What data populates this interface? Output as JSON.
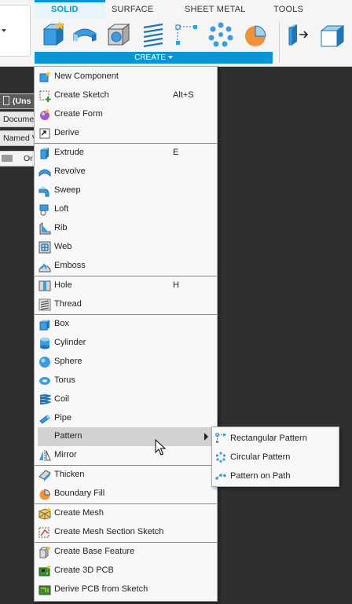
{
  "ribbon": {
    "tabs": [
      "SOLID",
      "SURFACE",
      "SHEET METAL",
      "TOOLS"
    ],
    "create_label": "CREATE"
  },
  "browser": {
    "unsaved": "(Uns",
    "document": "Docume",
    "named": "Named V",
    "origin": "Or"
  },
  "menu": {
    "items": [
      {
        "label": "New Component",
        "shortcut": "",
        "icon": "new-component-icon"
      },
      {
        "label": "Create Sketch",
        "shortcut": "Alt+S",
        "icon": "sketch-icon"
      },
      {
        "label": "Create Form",
        "shortcut": "",
        "icon": "form-icon"
      },
      {
        "label": "Derive",
        "shortcut": "",
        "icon": "derive-icon"
      },
      {
        "label": "Extrude",
        "shortcut": "E",
        "icon": "extrude-icon"
      },
      {
        "label": "Revolve",
        "shortcut": "",
        "icon": "revolve-icon"
      },
      {
        "label": "Sweep",
        "shortcut": "",
        "icon": "sweep-icon"
      },
      {
        "label": "Loft",
        "shortcut": "",
        "icon": "loft-icon"
      },
      {
        "label": "Rib",
        "shortcut": "",
        "icon": "rib-icon"
      },
      {
        "label": "Web",
        "shortcut": "",
        "icon": "web-icon"
      },
      {
        "label": "Emboss",
        "shortcut": "",
        "icon": "emboss-icon"
      },
      {
        "label": "Hole",
        "shortcut": "H",
        "icon": "hole-icon"
      },
      {
        "label": "Thread",
        "shortcut": "",
        "icon": "thread-icon"
      },
      {
        "label": "Box",
        "shortcut": "",
        "icon": "box-icon"
      },
      {
        "label": "Cylinder",
        "shortcut": "",
        "icon": "cylinder-icon"
      },
      {
        "label": "Sphere",
        "shortcut": "",
        "icon": "sphere-icon"
      },
      {
        "label": "Torus",
        "shortcut": "",
        "icon": "torus-icon"
      },
      {
        "label": "Coil",
        "shortcut": "",
        "icon": "coil-icon"
      },
      {
        "label": "Pipe",
        "shortcut": "",
        "icon": "pipe-icon"
      },
      {
        "label": "Pattern",
        "shortcut": "",
        "icon": ""
      },
      {
        "label": "Mirror",
        "shortcut": "",
        "icon": "mirror-icon"
      },
      {
        "label": "Thicken",
        "shortcut": "",
        "icon": "thicken-icon"
      },
      {
        "label": "Boundary Fill",
        "shortcut": "",
        "icon": "boundary-fill-icon"
      },
      {
        "label": "Create Mesh",
        "shortcut": "",
        "icon": "mesh-icon"
      },
      {
        "label": "Create Mesh Section Sketch",
        "shortcut": "",
        "icon": "mesh-section-sketch-icon"
      },
      {
        "label": "Create Base Feature",
        "shortcut": "",
        "icon": "base-feature-icon"
      },
      {
        "label": "Create 3D PCB",
        "shortcut": "",
        "icon": "pcb-3d-icon"
      },
      {
        "label": "Derive PCB from Sketch",
        "shortcut": "",
        "icon": "derive-pcb-icon"
      }
    ]
  },
  "pattern_submenu": {
    "items": [
      {
        "label": "Rectangular Pattern",
        "icon": "rectangular-pattern-icon"
      },
      {
        "label": "Circular Pattern",
        "icon": "circular-pattern-icon"
      },
      {
        "label": "Pattern on Path",
        "icon": "pattern-on-path-icon"
      }
    ]
  }
}
